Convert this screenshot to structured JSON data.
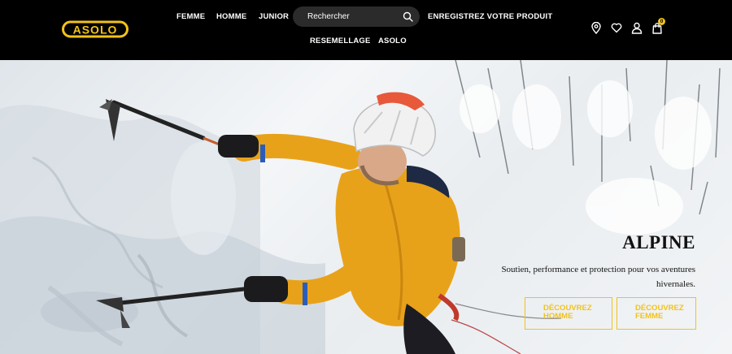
{
  "brand": {
    "logo_text": "ASOLO",
    "logo_color": "#f2c21b"
  },
  "nav": {
    "row1": [
      "FEMME",
      "HOMME",
      "JUNIOR"
    ],
    "row1_right": "ENREGISTREZ VOTRE PRODUIT",
    "row2": [
      "RESEMELLAGE",
      "ASOLO"
    ]
  },
  "search": {
    "placeholder": "Rechercher",
    "icon": "search-icon"
  },
  "header_icons": [
    "location-pin-icon",
    "heart-icon",
    "user-icon",
    "cart-icon"
  ],
  "cart": {
    "count": "0"
  },
  "hero": {
    "title": "ALPINE",
    "subtitle": "Soutien, performance et protection pour vos aventures hivernales.",
    "cta_homme": "DÉCOUVREZ HOMME",
    "cta_femme": "DÉCOUVREZ FEMME",
    "accent_color": "#f2c21b"
  }
}
